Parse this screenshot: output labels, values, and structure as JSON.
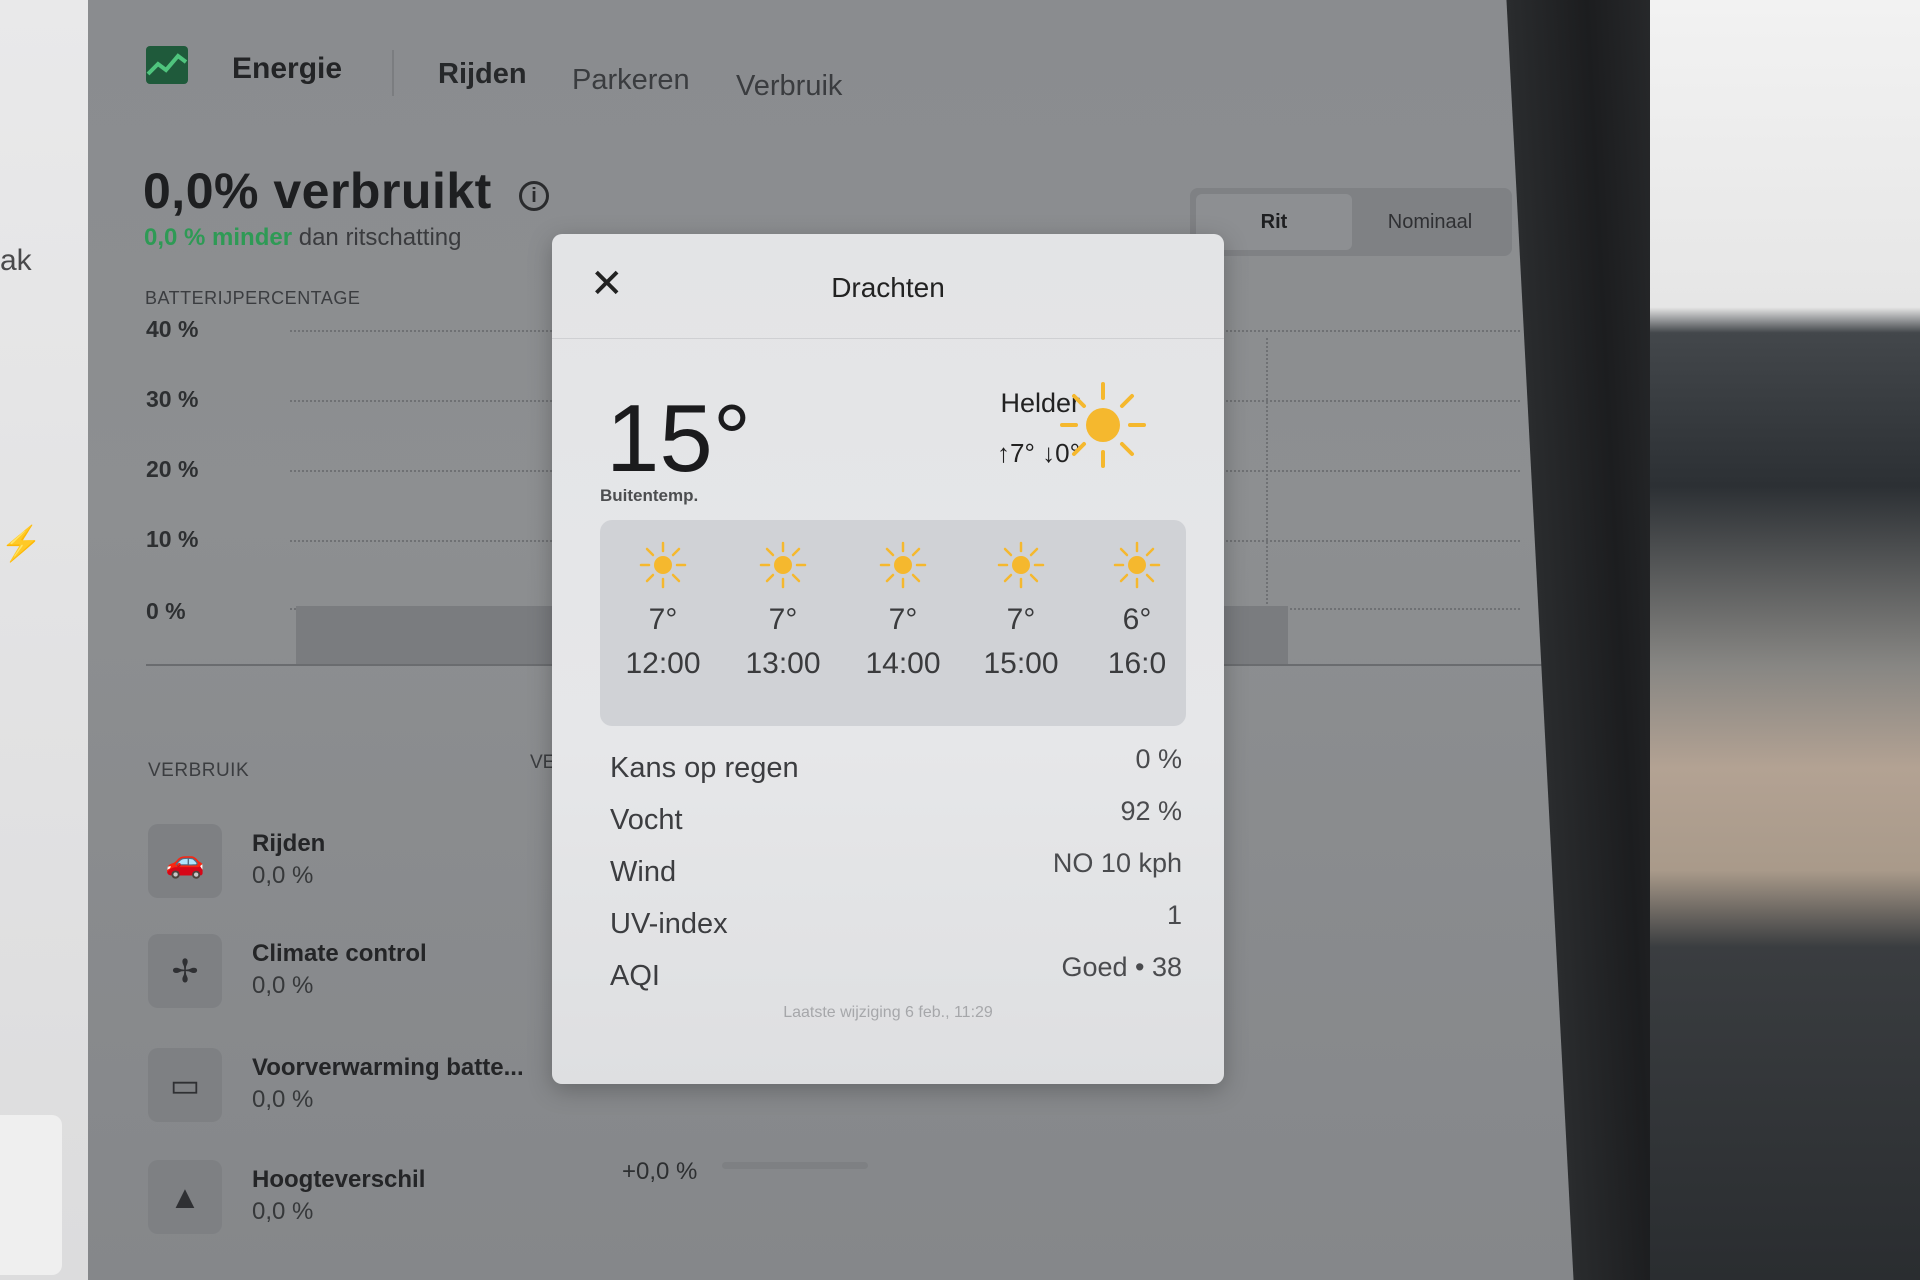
{
  "left_panel": {
    "side_text": "ak"
  },
  "nav": {
    "brand": "Energie",
    "items": [
      "Rijden",
      "Parkeren",
      "Verbruik"
    ]
  },
  "energy": {
    "consumed": "0,0% verbruikt",
    "sub_green": "0,0 % minder",
    "sub_rest": " dan ritschatting"
  },
  "segment": {
    "rit": "Rit",
    "nominaal": "Nominaal"
  },
  "chart": {
    "label": "BATTERIJPERCENTAGE",
    "yticks": [
      "40 %",
      "30 %",
      "20 %",
      "10 %",
      "0 %"
    ]
  },
  "verbruik": {
    "label": "VERBRUIK",
    "label2": "VER",
    "rows": [
      {
        "name": "Rijden",
        "value": "0,0 %",
        "icon": "car-icon"
      },
      {
        "name": "Climate control",
        "value": "0,0 %",
        "icon": "fan-icon"
      },
      {
        "name": "Voorverwarming batte...",
        "value": "0,0 %",
        "icon": "battery-icon"
      },
      {
        "name": "Hoogteverschil",
        "value": "0,0 %",
        "icon": "mountain-icon"
      }
    ],
    "hoogte_delta": "+0,0 %"
  },
  "weather": {
    "city": "Drachten",
    "temp": "15°",
    "temp_label": "Buitentemp.",
    "condition": "Helder",
    "hilo": "↑7°  ↓0°",
    "hourly": [
      {
        "temp": "7°",
        "time": "12:00"
      },
      {
        "temp": "7°",
        "time": "13:00"
      },
      {
        "temp": "7°",
        "time": "14:00"
      },
      {
        "temp": "7°",
        "time": "15:00"
      },
      {
        "temp": "6°",
        "time": "16:0"
      }
    ],
    "details": [
      {
        "label": "Kans op regen",
        "value": "0 %"
      },
      {
        "label": "Vocht",
        "value": "92 %"
      },
      {
        "label": "Wind",
        "value": "NO 10 kph"
      },
      {
        "label": "UV-index",
        "value": "1"
      },
      {
        "label": "AQI",
        "value": "Goed • 38"
      }
    ],
    "updated": "Laatste wijziging 6 feb., 11:29"
  },
  "colors": {
    "accent_green": "#2e9a55",
    "sun_yellow": "#f5b82e"
  }
}
